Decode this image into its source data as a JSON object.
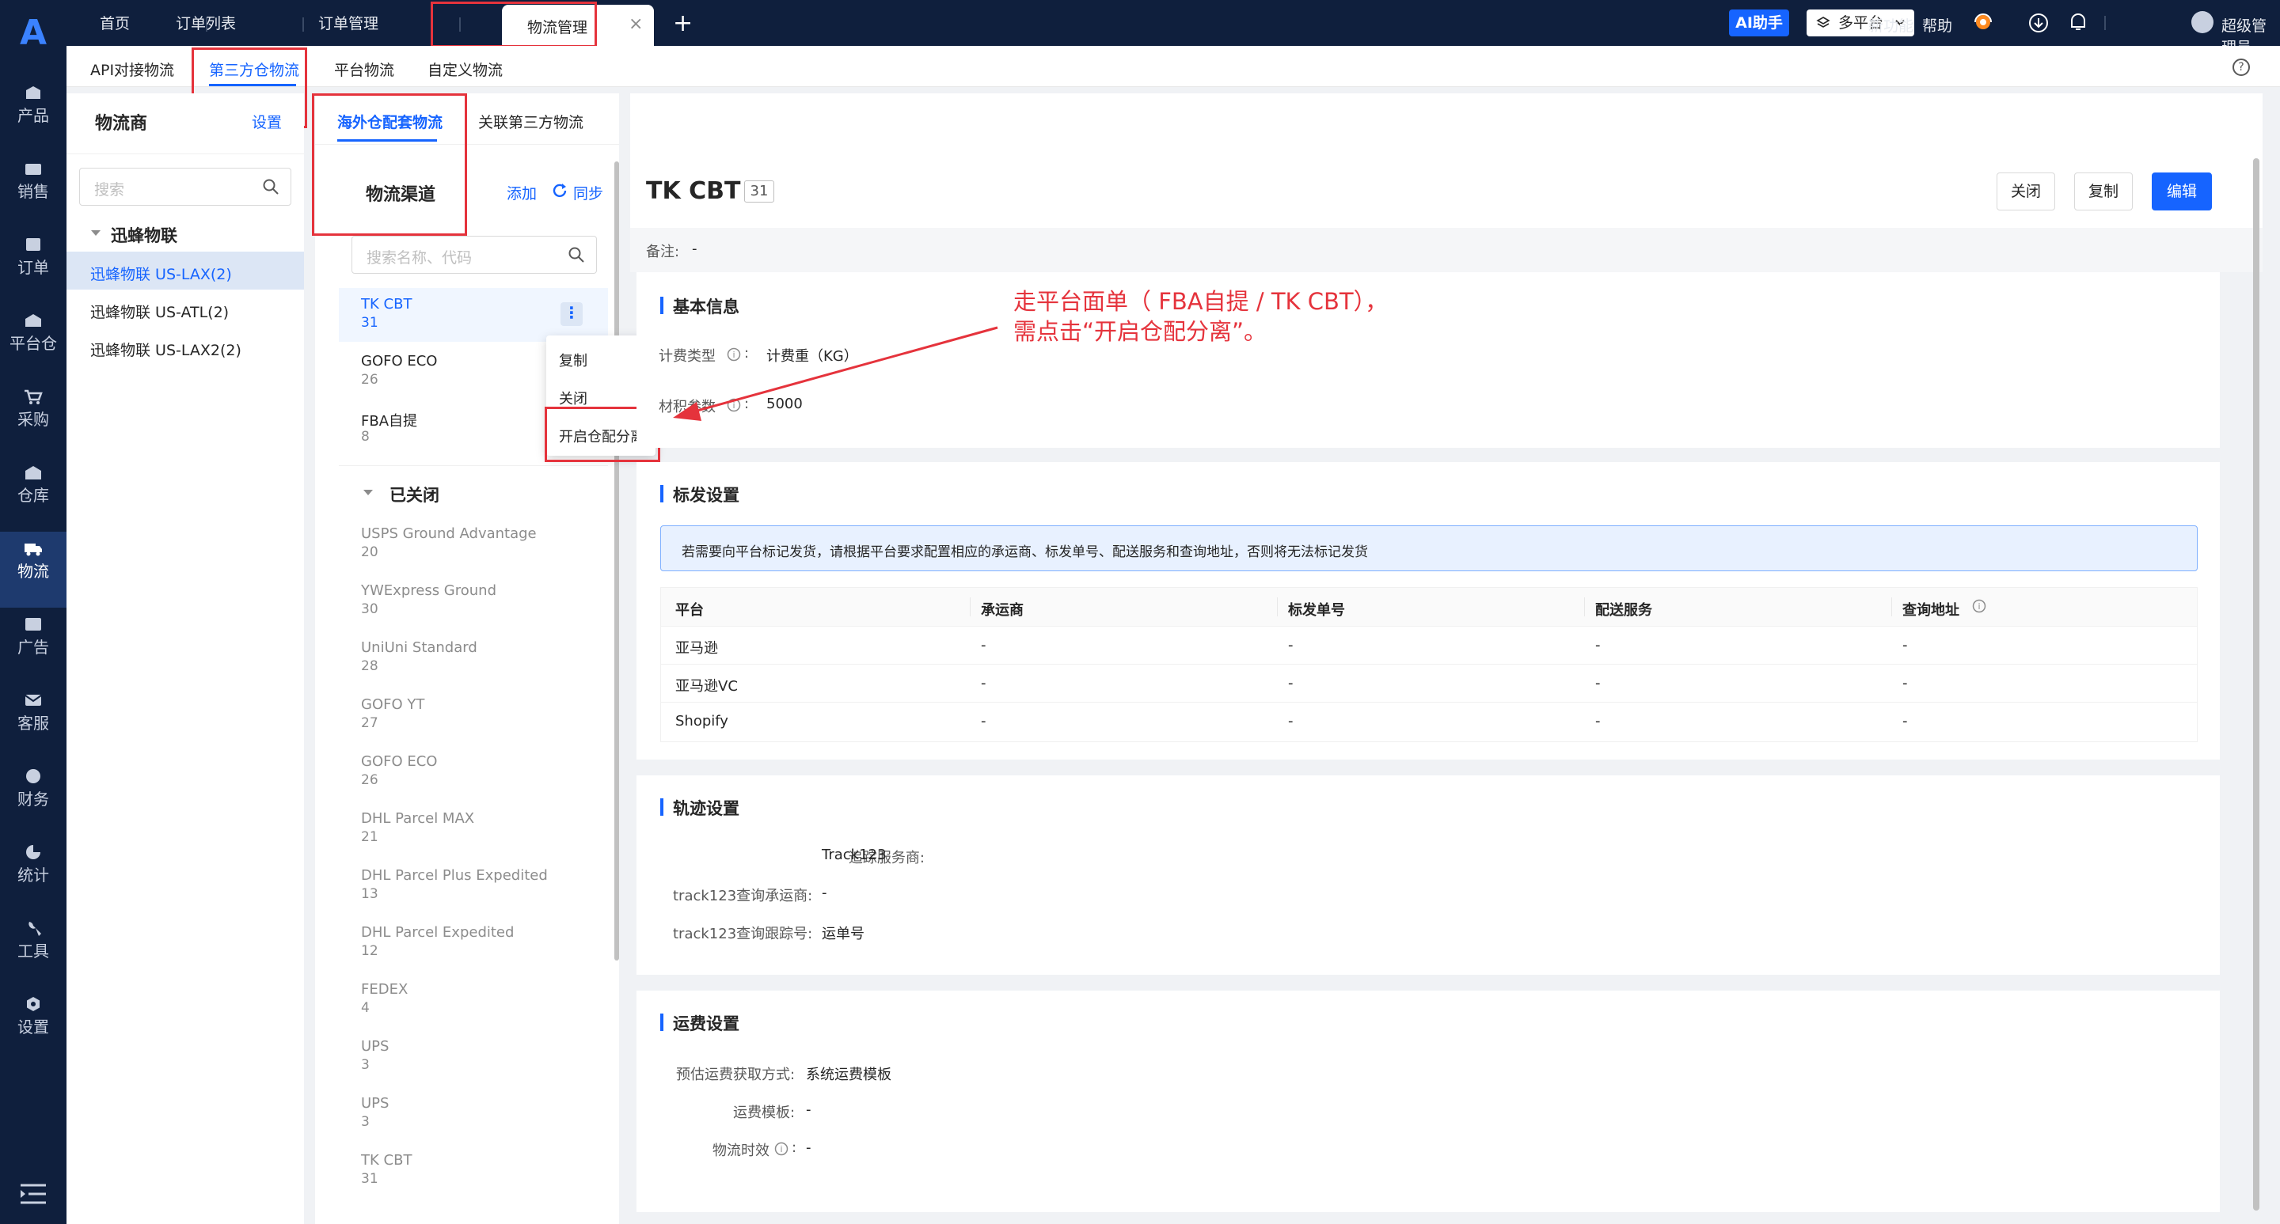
{
  "brand": {
    "accent": "#1664ff",
    "nav_bg": "#0f1f3d",
    "annot": "#e5333c"
  },
  "leftnav": {
    "items": [
      {
        "icon": "product-icon",
        "label": "产品"
      },
      {
        "icon": "sales-icon",
        "label": "销售"
      },
      {
        "icon": "order-icon",
        "label": "订单"
      },
      {
        "icon": "platform-warehouse-icon",
        "label": "平台仓"
      },
      {
        "icon": "purchase-icon",
        "label": "采购"
      },
      {
        "icon": "warehouse-icon",
        "label": "仓库"
      },
      {
        "icon": "logistics-icon",
        "label": "物流"
      },
      {
        "icon": "ads-icon",
        "label": "广告"
      },
      {
        "icon": "service-icon",
        "label": "客服"
      },
      {
        "icon": "finance-icon",
        "label": "财务"
      },
      {
        "icon": "stats-icon",
        "label": "统计"
      },
      {
        "icon": "tools-icon",
        "label": "工具"
      },
      {
        "icon": "settings-icon",
        "label": "设置"
      }
    ]
  },
  "topbar": {
    "tabs": [
      "首页",
      "订单列表",
      "订单管理"
    ],
    "active_tab": "物流管理",
    "ai_button": "AI助手",
    "platform_select": "多平台",
    "new_feature": "新功能",
    "help": "帮助",
    "user": "超级管理员"
  },
  "subnav": {
    "items": [
      "API对接物流",
      "第三方仓物流",
      "平台物流",
      "自定义物流"
    ]
  },
  "providers": {
    "title": "物流商",
    "settings": "设置",
    "search_placeholder": "搜索",
    "group": "迅蜂物联",
    "items": [
      "迅蜂物联 US-LAX(2)",
      "迅蜂物联 US-ATL(2)",
      "迅蜂物联 US-LAX2(2)"
    ]
  },
  "channels": {
    "tabs": [
      "海外仓配套物流",
      "关联第三方物流"
    ],
    "title": "物流渠道",
    "add": "添加",
    "sync": "同步",
    "search_placeholder": "搜索名称、代码",
    "active": [
      {
        "name": "TK CBT",
        "count": "31"
      },
      {
        "name": "GOFO ECO",
        "count": "26"
      },
      {
        "name": "FBA自提",
        "count": "8"
      }
    ],
    "closed_title": "已关闭",
    "closed": [
      {
        "name": "USPS Ground Advantage",
        "count": "20"
      },
      {
        "name": "YWExpress Ground",
        "count": "30"
      },
      {
        "name": "UniUni Standard",
        "count": "28"
      },
      {
        "name": "GOFO YT",
        "count": "27"
      },
      {
        "name": "GOFO ECO",
        "count": "26"
      },
      {
        "name": "DHL Parcel MAX",
        "count": "21"
      },
      {
        "name": "DHL Parcel Plus Expedited",
        "count": "13"
      },
      {
        "name": "DHL Parcel Expedited",
        "count": "12"
      },
      {
        "name": "FEDEX",
        "count": "4"
      },
      {
        "name": "UPS",
        "count": "3"
      },
      {
        "name": "UPS",
        "count": "3"
      },
      {
        "name": "TK CBT",
        "count": "31"
      }
    ],
    "context_menu": [
      "复制",
      "关闭",
      "开启仓配分离"
    ]
  },
  "detail": {
    "title": "TK CBT",
    "badge": "31",
    "buttons": {
      "close": "关闭",
      "copy": "复制",
      "edit": "编辑"
    },
    "remark_label": "备注:",
    "remark_value": "-",
    "basic": {
      "title": "基本信息",
      "fee_type_label": "计费类型",
      "fee_type_value": "计费重（KG）",
      "param_label": "材积参数",
      "param_value": "5000"
    },
    "annotation": {
      "line1": "走平台面单（ FBA自提 / TK CBT），",
      "line2": "需点击“开启仓配分离”。"
    },
    "mark": {
      "title": "标发设置",
      "alert": "若需要向平台标记发货，请根据平台要求配置相应的承运商、标发单号、配送服务和查询地址，否则将无法标记发货",
      "headers": [
        "平台",
        "承运商",
        "标发单号",
        "配送服务",
        "查询地址"
      ],
      "rows": [
        [
          "亚马逊",
          "-",
          "-",
          "-",
          "-"
        ],
        [
          "亚马逊VC",
          "-",
          "-",
          "-",
          "-"
        ],
        [
          "Shopify",
          "-",
          "-",
          "-",
          "-"
        ]
      ]
    },
    "track": {
      "title": "轨迹设置",
      "rows": [
        {
          "label": "追踪服务商:",
          "value": "Track123"
        },
        {
          "label": "track123查询承运商:",
          "value": "-"
        },
        {
          "label": "track123查询跟踪号:",
          "value": "运单号"
        }
      ]
    },
    "freight": {
      "title": "运费设置",
      "rows": [
        {
          "label": "预估运费获取方式:",
          "value": "系统运费模板"
        },
        {
          "label": "运费模板:",
          "value": "-"
        },
        {
          "label": "物流时效",
          "value": "-"
        }
      ]
    }
  }
}
